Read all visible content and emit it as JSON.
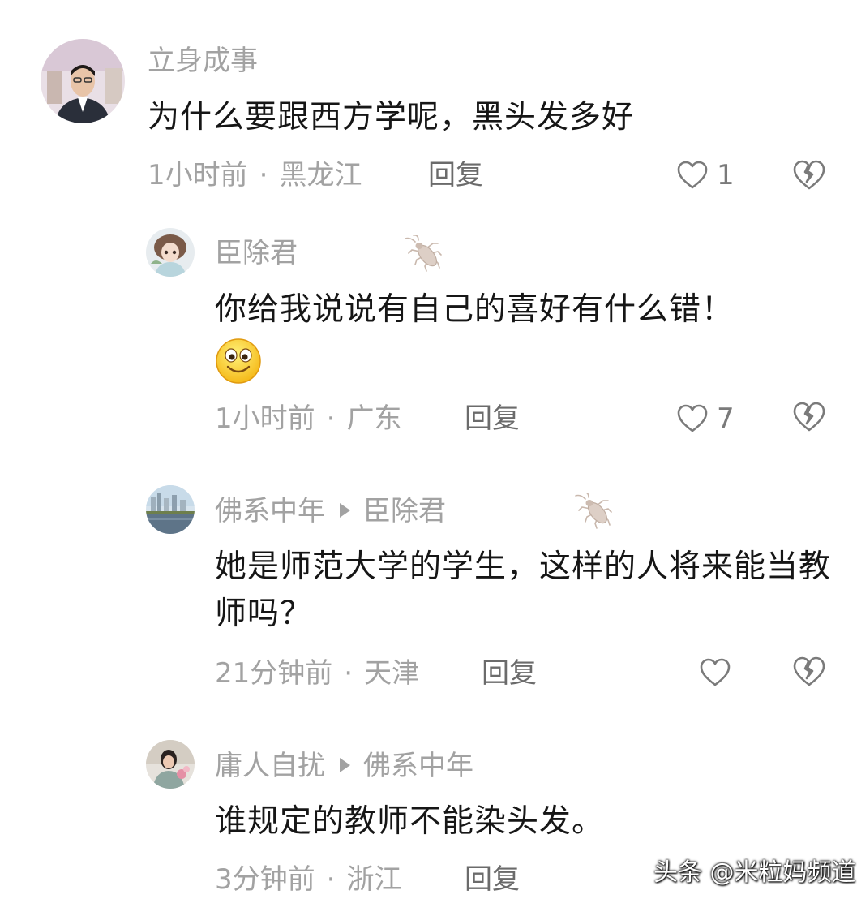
{
  "comments": [
    {
      "user": "立身成事",
      "text": "为什么要跟西方学呢，黑头发多好",
      "time": "1小时前",
      "location": "黑龙江",
      "reply": "回复",
      "likes": "1"
    },
    {
      "user": "臣除君",
      "text": "你给我说说有自己的喜好有什么错！",
      "emoji": "smiley-emoji",
      "time": "1小时前",
      "location": "广东",
      "reply": "回复",
      "likes": "7"
    },
    {
      "user": "佛系中年",
      "reply_to": "臣除君",
      "text": "她是师范大学的学生，这样的人将来能当教师吗？",
      "time": "21分钟前",
      "location": "天津",
      "reply": "回复",
      "likes": ""
    },
    {
      "user": "庸人自扰",
      "reply_to": "佛系中年",
      "text": "谁规定的教师不能染头发。",
      "time": "3分钟前",
      "location": "浙江",
      "reply": "回复"
    }
  ],
  "separator": "·",
  "watermark": "头条 @米粒妈频道",
  "icons": {
    "like": "heart-outline-icon",
    "dislike": "broken-heart-icon",
    "badge": "cockroach-icon",
    "arrow": "reply-arrow-icon"
  },
  "colors": {
    "text": "#161616",
    "muted": "#a2a2a2",
    "reply": "#6b6b6b"
  }
}
